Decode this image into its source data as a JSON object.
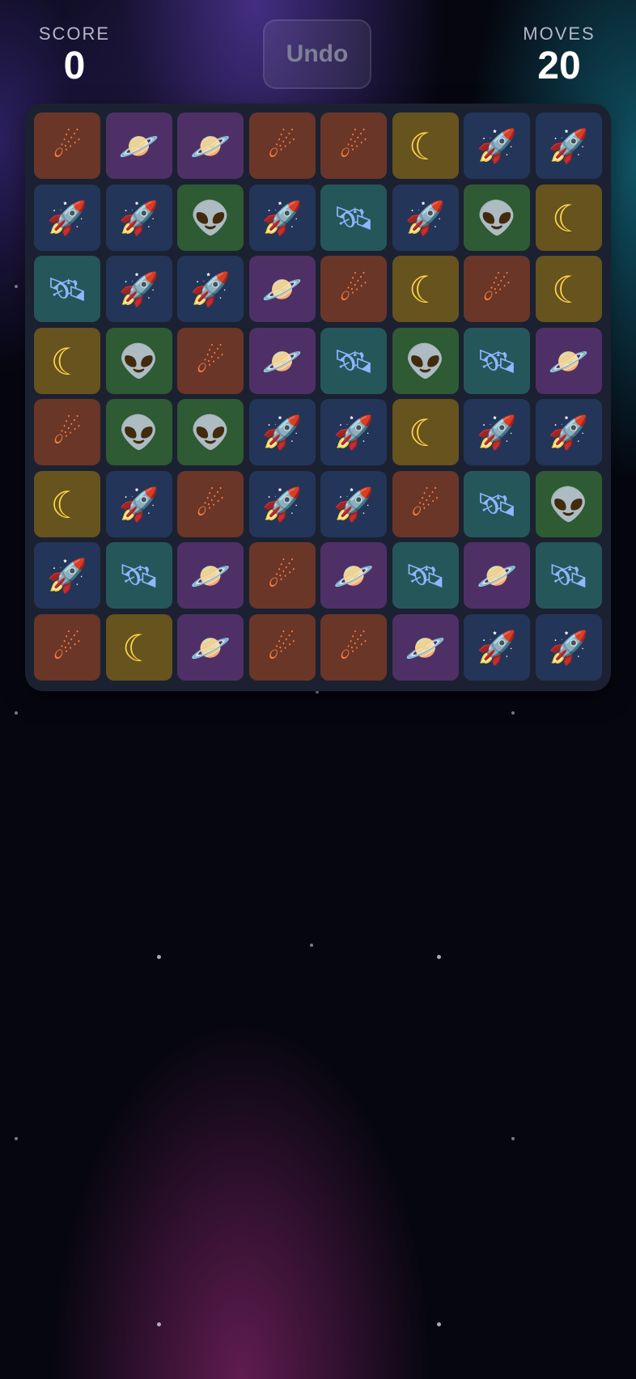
{
  "hud": {
    "score_label": "SCORE",
    "score_value": "0",
    "moves_label": "MOVES",
    "moves_value": "20",
    "undo_label": "Undo"
  },
  "tile_types": {
    "comet": {
      "icon": "comet-icon",
      "glyph": "☄",
      "color": "#6a3628"
    },
    "planet": {
      "icon": "planet-icon",
      "glyph": "🪐",
      "color": "#4e3066"
    },
    "moon": {
      "icon": "moon-icon",
      "glyph": "☾",
      "color": "#66531e"
    },
    "rocket": {
      "icon": "rocket-icon",
      "glyph": "🚀",
      "color": "#233659"
    },
    "alien": {
      "icon": "alien-icon",
      "glyph": "👽",
      "color": "#2e5a34"
    },
    "sat": {
      "icon": "satellite-icon",
      "glyph": "🛰",
      "color": "#25575a"
    }
  },
  "board": [
    [
      "comet",
      "planet",
      "planet",
      "comet",
      "comet",
      "moon",
      "rocket",
      "rocket"
    ],
    [
      "rocket",
      "rocket",
      "alien",
      "rocket",
      "sat",
      "rocket",
      "alien",
      "moon"
    ],
    [
      "sat",
      "rocket",
      "rocket",
      "planet",
      "comet",
      "moon",
      "comet",
      "moon"
    ],
    [
      "moon",
      "alien",
      "comet",
      "planet",
      "sat",
      "alien",
      "sat",
      "planet"
    ],
    [
      "comet",
      "alien",
      "alien",
      "rocket",
      "rocket",
      "moon",
      "rocket",
      "rocket"
    ],
    [
      "moon",
      "rocket",
      "comet",
      "rocket",
      "rocket",
      "comet",
      "sat",
      "alien"
    ],
    [
      "rocket",
      "sat",
      "planet",
      "comet",
      "planet",
      "sat",
      "planet",
      "sat"
    ],
    [
      "comet",
      "moon",
      "planet",
      "comet",
      "comet",
      "planet",
      "rocket",
      "rocket"
    ]
  ]
}
